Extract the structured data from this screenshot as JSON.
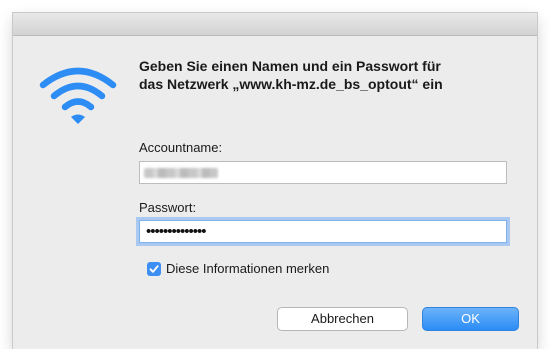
{
  "dialog": {
    "message_line1": "Geben Sie einen Namen und ein Passwort für",
    "message_line2": "das Netzwerk „www.kh-mz.de_bs_optout“ ein"
  },
  "account": {
    "label": "Accountname:",
    "value": "(obscured)"
  },
  "password": {
    "label": "Passwort:",
    "masked_value": "••••••••••••••"
  },
  "remember": {
    "label": "Diese Informationen merken",
    "checked": true
  },
  "buttons": {
    "cancel": "Abbrechen",
    "ok": "OK"
  },
  "colors": {
    "accent": "#2a8cf5",
    "wifi_icon": "#2d8df5",
    "dialog_bg": "#ececec"
  },
  "icons": {
    "network": "wifi-icon",
    "checkbox": "checkmark-icon"
  }
}
